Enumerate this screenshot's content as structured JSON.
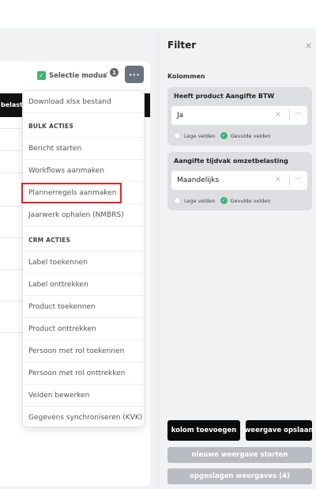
{
  "toolbar": {
    "selectie_label": "Selectie modus",
    "toggle_badge": "1",
    "more_label": "···"
  },
  "table": {
    "header_fragment": "belasti"
  },
  "dropdown": {
    "download": "Download xlsx bestand",
    "bulk_section": "BULK ACTIES",
    "bulk_items": [
      "Bericht starten",
      "Workflows aanmaken",
      "Plannerregels aanmaken",
      "Jaarwerk ophalen (NMBRS)"
    ],
    "crm_section": "CRM ACTIES",
    "crm_items": [
      "Label toekennen",
      "Label onttrekken",
      "Product toekennen",
      "Product onttrekken",
      "Persoon met rol toekennen",
      "Persoon met rol onttrekken",
      "Velden bewerken",
      "Gegevens synchroniseren (KVK)"
    ]
  },
  "filter": {
    "title": "Filter",
    "close": "×",
    "columns_label": "Kolommen",
    "cards": [
      {
        "title": "Heeft product Aangifte BTW",
        "value": "Ja",
        "empty_label": "Lege velden",
        "filled_label": "Gevulde velden"
      },
      {
        "title": "Aangifte tijdvak omzetbelasting",
        "value": "Maandelijks",
        "empty_label": "Lege velden",
        "filled_label": "Gevulde velden"
      }
    ],
    "buttons": {
      "add_column": "kolom toevoegen",
      "save_view": "weergave opslaan",
      "new_view": "nieuwe weergave starten",
      "saved_views": "opgeslagen weergaves (4)"
    }
  },
  "colors": {
    "highlight": "#e0262b",
    "check_green": "#3cb371",
    "primary_button": "#0a0a0a",
    "disabled_button": "#b9bcc2"
  }
}
